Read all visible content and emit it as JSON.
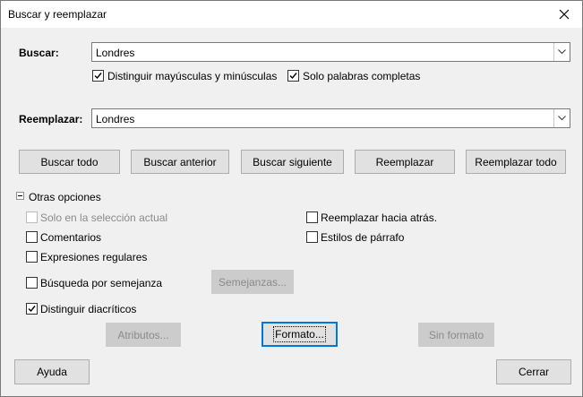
{
  "window": {
    "title": "Buscar y reemplazar"
  },
  "search": {
    "label": "Buscar:",
    "value": "Londres"
  },
  "options_top": {
    "match_case": {
      "label": "Distinguir mayúsculas y minúsculas",
      "checked": true
    },
    "whole_words": {
      "label": "Solo palabras completas",
      "checked": true
    }
  },
  "replace": {
    "label": "Reemplazar:",
    "value": "Londres"
  },
  "actions": {
    "find_all": "Buscar todo",
    "find_prev": "Buscar anterior",
    "find_next": "Buscar siguiente",
    "replace": "Reemplazar",
    "replace_all": "Reemplazar todo"
  },
  "other_options": {
    "header": "Otras opciones",
    "selection_only": {
      "label": "Solo en la selección actual",
      "checked": false,
      "enabled": false
    },
    "comments": {
      "label": "Comentarios",
      "checked": false
    },
    "regex": {
      "label": "Expresiones regulares",
      "checked": false
    },
    "similarity": {
      "label": "Búsqueda por semejanza",
      "checked": false
    },
    "similarity_button": "Semejanzas...",
    "diacritics": {
      "label": "Distinguir diacríticos",
      "checked": true
    },
    "replace_backwards": {
      "label": "Reemplazar hacia atrás.",
      "checked": false
    },
    "paragraph_styles": {
      "label": "Estilos de párrafo",
      "checked": false
    },
    "attributes_button": "Atributos...",
    "format_button": "Formato...",
    "no_format_button": "Sin formato"
  },
  "footer": {
    "help": "Ayuda",
    "close": "Cerrar"
  }
}
